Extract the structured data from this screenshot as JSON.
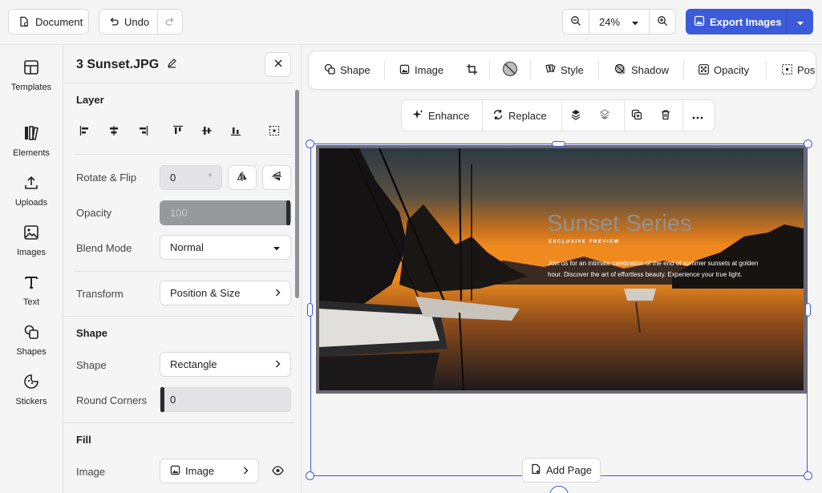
{
  "topbar": {
    "document_label": "Document",
    "undo_label": "Undo",
    "zoom_value": "24%",
    "export_label": "Export Images"
  },
  "rail": {
    "items": [
      {
        "label": "Templates",
        "icon": "templates-icon"
      },
      {
        "label": "Elements",
        "icon": "elements-icon"
      },
      {
        "label": "Uploads",
        "icon": "upload-icon"
      },
      {
        "label": "Images",
        "icon": "image-icon"
      },
      {
        "label": "Text",
        "icon": "text-icon"
      },
      {
        "label": "Shapes",
        "icon": "shapes-icon"
      },
      {
        "label": "Stickers",
        "icon": "sticker-icon"
      }
    ]
  },
  "panel": {
    "title": "3 Sunset.JPG",
    "layer_section": "Layer",
    "rotate_label": "Rotate & Flip",
    "rotate_value": "0",
    "rotate_unit": "°",
    "opacity_label": "Opacity",
    "opacity_value": "100",
    "blend_label": "Blend Mode",
    "blend_value": "Normal",
    "transform_label": "Transform",
    "transform_value": "Position & Size",
    "shape_section": "Shape",
    "shape_label": "Shape",
    "shape_value": "Rectangle",
    "corners_label": "Round Corners",
    "corners_value": "0",
    "fill_section": "Fill",
    "image_label": "Image",
    "image_value": "Image"
  },
  "toolbar": {
    "items": [
      "Shape",
      "Image",
      "Style",
      "Shadow",
      "Opacity",
      "Posi"
    ]
  },
  "context_toolbar": {
    "enhance": "Enhance",
    "replace": "Replace"
  },
  "design": {
    "title": "Sunset Series",
    "subtitle": "EXCLUSIVE PREVIEW",
    "body": "Join us for an intimate celebration of the end of summer sunsets at golden hour. Discover the art of effortless beauty. Experience your true light."
  },
  "add_page_label": "Add Page",
  "colors": {
    "accent": "#3b5bdb",
    "selection": "#3b5bdb"
  }
}
